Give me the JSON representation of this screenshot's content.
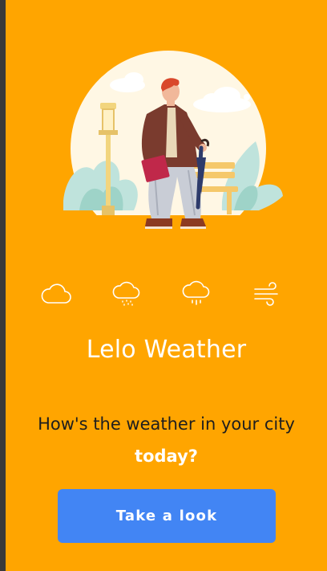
{
  "app": {
    "title": "Lelo Weather",
    "tagline_prefix": "How's the weather in your city ",
    "tagline_emphasis": "today?"
  },
  "weather_icons": [
    "cloud-icon",
    "cloud-drizzle-icon",
    "cloud-rain-icon",
    "wind-icon"
  ],
  "cta": {
    "label": "Take a look"
  },
  "colors": {
    "background": "#FFA500",
    "button": "#4285F4",
    "title_text": "#FFFFFF",
    "body_text": "#1E1E1E"
  }
}
